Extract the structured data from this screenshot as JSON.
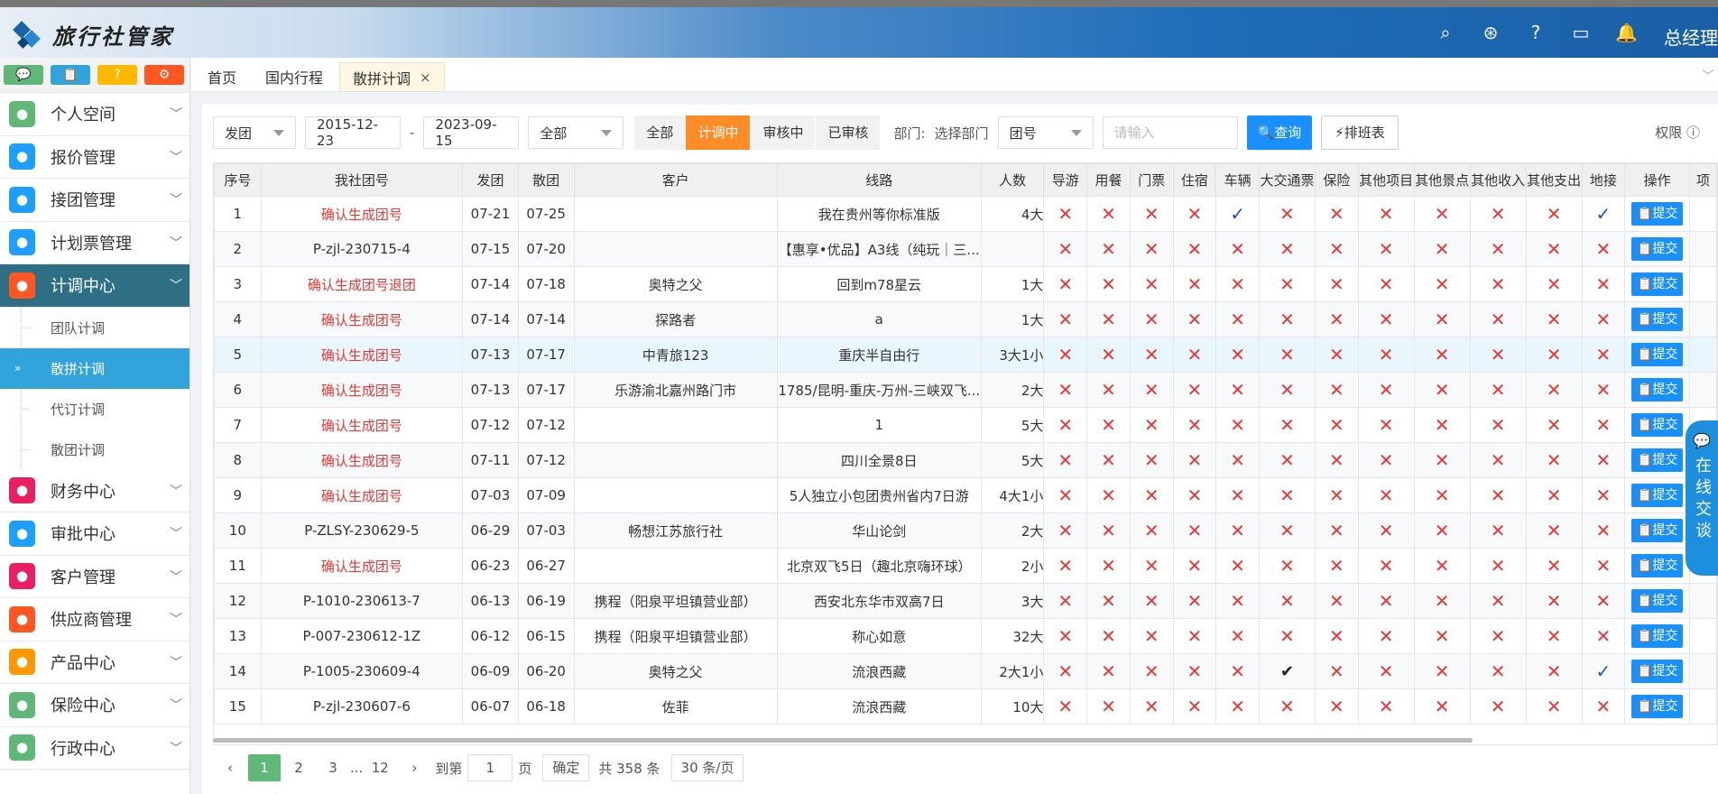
{
  "header": {
    "logo_text": "旅行社管家",
    "username": "总经理",
    "icons": [
      "search-icon",
      "compass-icon",
      "help-icon",
      "monitor-icon",
      "bell-icon"
    ]
  },
  "quick_buttons": [
    {
      "name": "chat-icon",
      "color": "#5fb878",
      "glyph": "💬"
    },
    {
      "name": "clipboard-icon",
      "color": "#33a3dc",
      "glyph": "📋"
    },
    {
      "name": "help-icon",
      "color": "#ffb800",
      "glyph": "?"
    },
    {
      "name": "settings-icon",
      "color": "#ff5722",
      "glyph": "⚙"
    }
  ],
  "sidebar": {
    "items": [
      {
        "label": "个人空间",
        "icon": "user-icon",
        "color": "#5fb878"
      },
      {
        "label": "报价管理",
        "icon": "price-icon",
        "color": "#1e9fff"
      },
      {
        "label": "接团管理",
        "icon": "group-icon",
        "color": "#1e9fff"
      },
      {
        "label": "计划票管理",
        "icon": "plane-icon",
        "color": "#1e9fff"
      },
      {
        "label": "计调中心",
        "icon": "edit-icon",
        "color": "#ff5722",
        "active": true
      }
    ],
    "subitems": [
      {
        "label": "团队计调"
      },
      {
        "label": "散拼计调",
        "active": true
      },
      {
        "label": "代订计调"
      },
      {
        "label": "散团计调"
      }
    ],
    "items2": [
      {
        "label": "财务中心",
        "icon": "finance-icon",
        "color": "#e91e63"
      },
      {
        "label": "审批中心",
        "icon": "approve-icon",
        "color": "#1e9fff"
      },
      {
        "label": "客户管理",
        "icon": "customer-icon",
        "color": "#e91e63"
      },
      {
        "label": "供应商管理",
        "icon": "cart-icon",
        "color": "#ff5722"
      },
      {
        "label": "产品中心",
        "icon": "product-icon",
        "color": "#ff9800"
      },
      {
        "label": "保险中心",
        "icon": "insurance-icon",
        "color": "#5fb878"
      },
      {
        "label": "行政中心",
        "icon": "org-icon",
        "color": "#5fb878"
      }
    ]
  },
  "tabs": [
    {
      "label": "首页"
    },
    {
      "label": "国内行程"
    },
    {
      "label": "散拼计调",
      "active": true,
      "close": "×"
    }
  ],
  "filter": {
    "type_select": "发团",
    "date_from": "2015-12-23",
    "date_sep": "-",
    "date_to": "2023-09-15",
    "scope_select": "全部",
    "status": [
      {
        "label": "全部"
      },
      {
        "label": "计调中",
        "on": true
      },
      {
        "label": "审核中"
      },
      {
        "label": "已审核"
      }
    ],
    "dept_label": "部门:",
    "dept_value": "选择部门",
    "field_select": "团号",
    "search_placeholder": "请输入",
    "query_label": "🔍查询",
    "plan_label": "⚡排班表",
    "perm_label": "权限 ⓘ"
  },
  "table": {
    "headers": [
      "序号",
      "我社团号",
      "发团",
      "散团",
      "客户",
      "线路",
      "人数",
      "导游",
      "用餐",
      "门票",
      "住宿",
      "车辆",
      "大交通票",
      "保险",
      "其他项目",
      "其他景点",
      "其他收入",
      "其他支出",
      "地接",
      "操作",
      "项"
    ],
    "submit_label": "📋提交",
    "rows": [
      {
        "no": "1",
        "code": "确认生成团号",
        "red": true,
        "start": "07-21",
        "end": "07-25",
        "customer": "",
        "route": "我在贵州等你标准版",
        "people": "4大",
        "marks": [
          "x",
          "x",
          "x",
          "x",
          "v",
          "x",
          "x",
          "x",
          "x",
          "x",
          "x",
          "v"
        ]
      },
      {
        "no": "2",
        "code": "P-zjl-230715-4",
        "red": false,
        "start": "07-15",
        "end": "07-20",
        "customer": "",
        "route": "【惠享•优品】A3线（纯玩｜三...",
        "people": "",
        "marks": [
          "x",
          "x",
          "x",
          "x",
          "x",
          "x",
          "x",
          "x",
          "x",
          "x",
          "x",
          "x"
        ]
      },
      {
        "no": "3",
        "code": "确认生成团号退团",
        "red": true,
        "start": "07-14",
        "end": "07-18",
        "customer": "奥特之父",
        "route": "回到m78星云",
        "people": "1大",
        "marks": [
          "x",
          "x",
          "x",
          "x",
          "x",
          "x",
          "x",
          "x",
          "x",
          "x",
          "x",
          "x"
        ]
      },
      {
        "no": "4",
        "code": "确认生成团号",
        "red": true,
        "start": "07-14",
        "end": "07-14",
        "customer": "探路者",
        "route": "a",
        "people": "1大",
        "marks": [
          "x",
          "x",
          "x",
          "x",
          "x",
          "x",
          "x",
          "x",
          "x",
          "x",
          "x",
          "x"
        ]
      },
      {
        "no": "5",
        "code": "确认生成团号",
        "red": true,
        "start": "07-13",
        "end": "07-17",
        "customer": "中青旅123",
        "route": "重庆半自由行",
        "people": "3大1小",
        "marks": [
          "x",
          "x",
          "x",
          "x",
          "x",
          "x",
          "x",
          "x",
          "x",
          "x",
          "x",
          "x"
        ]
      },
      {
        "no": "6",
        "code": "确认生成团号",
        "red": true,
        "start": "07-13",
        "end": "07-17",
        "customer": "乐游渝北嘉州路门市",
        "route": "1785/昆明-重庆-万州-三峡双飞...",
        "people": "2大",
        "marks": [
          "x",
          "x",
          "x",
          "x",
          "x",
          "x",
          "x",
          "x",
          "x",
          "x",
          "x",
          "x"
        ]
      },
      {
        "no": "7",
        "code": "确认生成团号",
        "red": true,
        "start": "07-12",
        "end": "07-12",
        "customer": "",
        "route": "1",
        "people": "5大",
        "marks": [
          "x",
          "x",
          "x",
          "x",
          "x",
          "x",
          "x",
          "x",
          "x",
          "x",
          "x",
          "x"
        ]
      },
      {
        "no": "8",
        "code": "确认生成团号",
        "red": true,
        "start": "07-11",
        "end": "07-12",
        "customer": "",
        "route": "四川全景8日",
        "people": "5大",
        "marks": [
          "x",
          "x",
          "x",
          "x",
          "x",
          "x",
          "x",
          "x",
          "x",
          "x",
          "x",
          "x"
        ]
      },
      {
        "no": "9",
        "code": "确认生成团号",
        "red": true,
        "start": "07-03",
        "end": "07-09",
        "customer": "",
        "route": "5人独立小包团贵州省内7日游",
        "people": "4大1小",
        "marks": [
          "x",
          "x",
          "x",
          "x",
          "x",
          "x",
          "x",
          "x",
          "x",
          "x",
          "x",
          "x"
        ]
      },
      {
        "no": "10",
        "code": "P-ZLSY-230629-5",
        "red": false,
        "start": "06-29",
        "end": "07-03",
        "customer": "畅想江苏旅行社",
        "route": "华山论剑",
        "people": "2大",
        "marks": [
          "x",
          "x",
          "x",
          "x",
          "x",
          "x",
          "x",
          "x",
          "x",
          "x",
          "x",
          "x"
        ]
      },
      {
        "no": "11",
        "code": "确认生成团号",
        "red": true,
        "start": "06-23",
        "end": "06-27",
        "customer": "",
        "route": "北京双飞5日（趣北京嗨环球）",
        "people": "2小",
        "marks": [
          "x",
          "x",
          "x",
          "x",
          "x",
          "x",
          "x",
          "x",
          "x",
          "x",
          "x",
          "x"
        ]
      },
      {
        "no": "12",
        "code": "P-1010-230613-7",
        "red": false,
        "start": "06-13",
        "end": "06-19",
        "customer": "携程（阳泉平坦镇营业部）",
        "route": "西安北东华市双高7日",
        "people": "3大",
        "marks": [
          "x",
          "x",
          "x",
          "x",
          "x",
          "x",
          "x",
          "x",
          "x",
          "x",
          "x",
          "x"
        ]
      },
      {
        "no": "13",
        "code": "P-007-230612-1Z",
        "red": false,
        "start": "06-12",
        "end": "06-15",
        "customer": "携程（阳泉平坦镇营业部）",
        "route": "称心如意",
        "people": "32大",
        "marks": [
          "x",
          "x",
          "x",
          "x",
          "x",
          "x",
          "x",
          "x",
          "x",
          "x",
          "x",
          "x"
        ]
      },
      {
        "no": "14",
        "code": "P-1005-230609-4",
        "red": false,
        "start": "06-09",
        "end": "06-20",
        "customer": "奥特之父",
        "route": "流浪西藏",
        "people": "2大1小",
        "marks": [
          "x",
          "x",
          "x",
          "x",
          "x",
          "k",
          "x",
          "x",
          "x",
          "x",
          "x",
          "v"
        ]
      },
      {
        "no": "15",
        "code": "P-zjl-230607-6",
        "red": false,
        "start": "06-07",
        "end": "06-18",
        "customer": "佐菲",
        "route": "流浪西藏",
        "people": "10大",
        "marks": [
          "x",
          "x",
          "x",
          "x",
          "x",
          "x",
          "x",
          "x",
          "x",
          "x",
          "x",
          "x"
        ]
      }
    ]
  },
  "pager": {
    "prev": "‹",
    "pages": [
      "1",
      "2",
      "3"
    ],
    "ellipsis": "...",
    "last": "12",
    "next": "›",
    "goto_label": "到第",
    "goto_value": "1",
    "page_unit": "页",
    "confirm": "确定",
    "total": "共 358 条",
    "size": "30 条/页"
  },
  "chat": {
    "label": "在线交谈"
  }
}
